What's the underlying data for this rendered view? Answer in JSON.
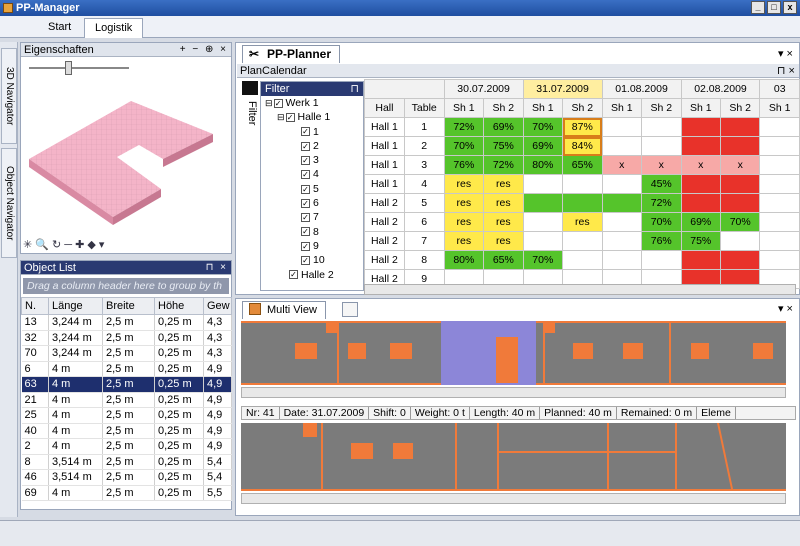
{
  "window": {
    "title": "PP-Manager",
    "buttons": [
      "_",
      "□",
      "x"
    ]
  },
  "ribbon": {
    "tabs": [
      "Start",
      "Logistik"
    ],
    "active": "Logistik"
  },
  "sidetabs": {
    "top": "3D Navigator",
    "bottom": "Object Navigator"
  },
  "eigenschaften": {
    "title": "Eigenschaften",
    "buttons": "+ − ⊕ ×"
  },
  "objectlist": {
    "title": "Object List",
    "group_hint": "Drag a column header here to group by th",
    "columns": [
      "N.",
      "Länge",
      "Breite",
      "Höhe",
      "Gew"
    ],
    "rows": [
      [
        "13",
        "3,244 m",
        "2,5 m",
        "0,25 m",
        "4,3"
      ],
      [
        "32",
        "3,244 m",
        "2,5 m",
        "0,25 m",
        "4,3"
      ],
      [
        "70",
        "3,244 m",
        "2,5 m",
        "0,25 m",
        "4,3"
      ],
      [
        "6",
        "4 m",
        "2,5 m",
        "0,25 m",
        "4,9"
      ],
      [
        "63",
        "4 m",
        "2,5 m",
        "0,25 m",
        "4,9"
      ],
      [
        "21",
        "4 m",
        "2,5 m",
        "0,25 m",
        "4,9"
      ],
      [
        "25",
        "4 m",
        "2,5 m",
        "0,25 m",
        "4,9"
      ],
      [
        "40",
        "4 m",
        "2,5 m",
        "0,25 m",
        "4,9"
      ],
      [
        "2",
        "4 m",
        "2,5 m",
        "0,25 m",
        "4,9"
      ],
      [
        "8",
        "3,514 m",
        "2,5 m",
        "0,25 m",
        "5,4"
      ],
      [
        "46",
        "3,514 m",
        "2,5 m",
        "0,25 m",
        "5,4"
      ],
      [
        "69",
        "4 m",
        "2,5 m",
        "0,25 m",
        "5,5"
      ]
    ],
    "selected_index": 4
  },
  "planner": {
    "tab": "PP-Planner",
    "calendar_title": "PlanCalendar",
    "filter_label": "Filter",
    "filter_vertical": "Filter",
    "tree": {
      "werk": "Werk 1",
      "halle1": "Halle 1",
      "tables": [
        "1",
        "2",
        "3",
        "4",
        "5",
        "6",
        "7",
        "8",
        "9",
        "10"
      ],
      "halle2": "Halle 2"
    },
    "dates": [
      "30.07.2009",
      "31.07.2009",
      "01.08.2009",
      "02.08.2009",
      "03"
    ],
    "hdr_hall": "Hall",
    "hdr_table": "Table",
    "shifts": [
      "Sh 1",
      "Sh 2",
      "Sh 1",
      "Sh 2",
      "Sh 1",
      "Sh 2",
      "Sh 1",
      "Sh 2",
      "Sh 1"
    ],
    "rows": [
      {
        "hall": "Hall 1",
        "table": "1",
        "cells": [
          [
            "72%",
            "g"
          ],
          [
            "69%",
            "g"
          ],
          [
            "70%",
            "g"
          ],
          [
            "87%",
            "y o"
          ],
          [
            "",
            "w"
          ],
          [
            "",
            "w"
          ],
          [
            "",
            "r"
          ],
          [
            "",
            "r"
          ],
          [
            "",
            "w"
          ]
        ]
      },
      {
        "hall": "Hall 1",
        "table": "2",
        "cells": [
          [
            "70%",
            "g"
          ],
          [
            "75%",
            "g"
          ],
          [
            "69%",
            "g"
          ],
          [
            "84%",
            "y o"
          ],
          [
            "",
            "w"
          ],
          [
            "",
            "w"
          ],
          [
            "",
            "r"
          ],
          [
            "",
            "r"
          ],
          [
            "",
            "w"
          ]
        ]
      },
      {
        "hall": "Hall 1",
        "table": "3",
        "cells": [
          [
            "76%",
            "g"
          ],
          [
            "72%",
            "g"
          ],
          [
            "80%",
            "g"
          ],
          [
            "65%",
            "g"
          ],
          [
            "x",
            "p"
          ],
          [
            "x",
            "p"
          ],
          [
            "x",
            "p"
          ],
          [
            "x",
            "p"
          ],
          [
            "",
            "w"
          ]
        ]
      },
      {
        "hall": "Hall 1",
        "table": "4",
        "cells": [
          [
            "res",
            "y"
          ],
          [
            "res",
            "y"
          ],
          [
            "",
            "w"
          ],
          [
            "",
            "w"
          ],
          [
            "",
            "w"
          ],
          [
            "45%",
            "g"
          ],
          [
            "",
            "r"
          ],
          [
            "",
            "r"
          ],
          [
            "",
            "w"
          ]
        ]
      },
      {
        "hall": "Hall 2",
        "table": "5",
        "cells": [
          [
            "res",
            "y"
          ],
          [
            "res",
            "y"
          ],
          [
            "",
            "g"
          ],
          [
            "",
            "g"
          ],
          [
            "",
            "g"
          ],
          [
            "72%",
            "g"
          ],
          [
            "",
            "r"
          ],
          [
            "",
            "r"
          ],
          [
            "",
            "w"
          ]
        ]
      },
      {
        "hall": "Hall 2",
        "table": "6",
        "cells": [
          [
            "res",
            "y"
          ],
          [
            "res",
            "y"
          ],
          [
            "",
            "w"
          ],
          [
            "res",
            "y"
          ],
          [
            "",
            "w"
          ],
          [
            "70%",
            "g"
          ],
          [
            "69%",
            "g"
          ],
          [
            "70%",
            "g"
          ],
          [
            "",
            "w"
          ]
        ]
      },
      {
        "hall": "Hall 2",
        "table": "7",
        "cells": [
          [
            "res",
            "y"
          ],
          [
            "res",
            "y"
          ],
          [
            "",
            "w"
          ],
          [
            "",
            "w"
          ],
          [
            "",
            "w"
          ],
          [
            "76%",
            "g"
          ],
          [
            "75%",
            "g"
          ],
          [
            "",
            "w"
          ],
          [
            "",
            "w"
          ]
        ]
      },
      {
        "hall": "Hall 2",
        "table": "8",
        "cells": [
          [
            "80%",
            "g"
          ],
          [
            "65%",
            "g"
          ],
          [
            "70%",
            "g"
          ],
          [
            "",
            "w"
          ],
          [
            "",
            "w"
          ],
          [
            "",
            "w"
          ],
          [
            "",
            "r"
          ],
          [
            "",
            "r"
          ],
          [
            "",
            "w"
          ]
        ]
      },
      {
        "hall": "Hall 2",
        "table": "9",
        "cells": [
          [
            "",
            "w"
          ],
          [
            "",
            "w"
          ],
          [
            "",
            "w"
          ],
          [
            "",
            "w"
          ],
          [
            "",
            "w"
          ],
          [
            "",
            "w"
          ],
          [
            "",
            "r"
          ],
          [
            "",
            "r"
          ],
          [
            "",
            "w"
          ]
        ]
      }
    ]
  },
  "multiview": {
    "tab": "Multi View",
    "info": [
      "Nr: 41",
      "Date: 31.07.2009",
      "Shift: 0",
      "Weight: 0 t",
      "Length: 40 m",
      "Planned: 40 m",
      "Remained: 0 m",
      "Eleme"
    ]
  },
  "colors": {
    "green": "#55c42b",
    "yellow": "#ffe94a",
    "red": "#e8322a",
    "pink": "#f7a9a7",
    "orange": "#f07a3a",
    "purple": "#8c86d8",
    "selection": "#1e2f6e"
  }
}
